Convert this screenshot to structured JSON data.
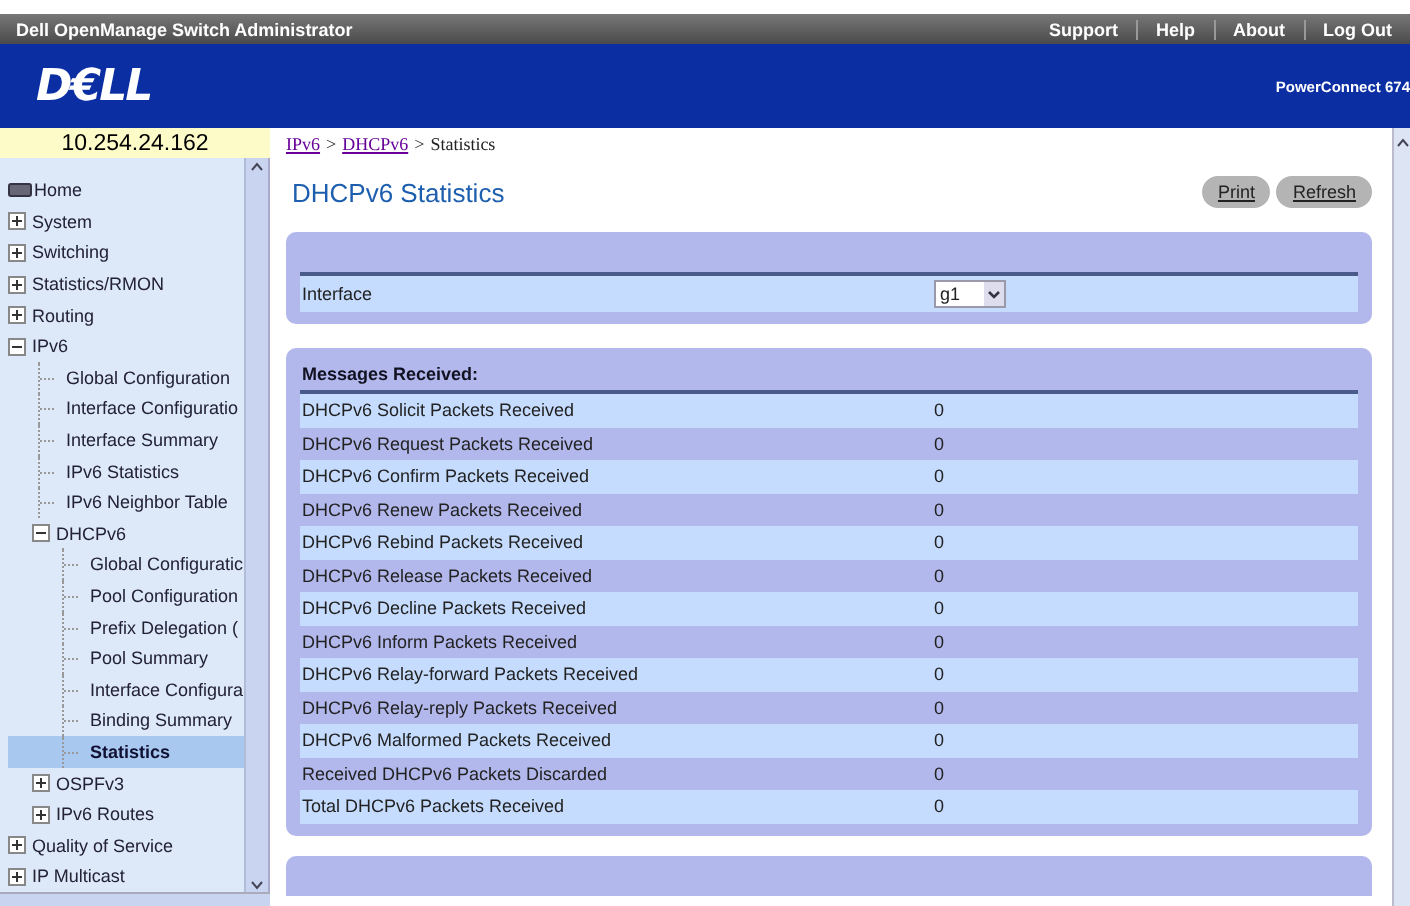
{
  "header": {
    "title": "Dell OpenManage Switch Administrator",
    "links": [
      "Support",
      "Help",
      "About",
      "Log Out"
    ],
    "logo": "D€LL",
    "model": "PowerConnect 674"
  },
  "ip_address": "10.254.24.162",
  "breadcrumb": [
    {
      "label": "IPv6",
      "kind": "link"
    },
    {
      "label": ">",
      "kind": "separator"
    },
    {
      "label": "DHCPv6",
      "kind": "link"
    },
    {
      "label": ">",
      "kind": "separator"
    },
    {
      "label": "Statistics",
      "kind": "current"
    }
  ],
  "sidebar": {
    "items": [
      {
        "label": "Home",
        "kind": "home",
        "selected": false
      },
      {
        "label": "System",
        "kind": "folder",
        "expanded": false,
        "selected": false
      },
      {
        "label": "Switching",
        "kind": "folder",
        "expanded": false,
        "selected": false
      },
      {
        "label": "Statistics/RMON",
        "kind": "folder",
        "expanded": false,
        "selected": false
      },
      {
        "label": "Routing",
        "kind": "folder",
        "expanded": false,
        "selected": false
      },
      {
        "label": "IPv6",
        "kind": "folder",
        "expanded": true,
        "selected": false,
        "children": [
          {
            "label": "Global Configuration",
            "kind": "leaf",
            "selected": false
          },
          {
            "label": "Interface Configuratio",
            "kind": "leaf",
            "selected": false
          },
          {
            "label": "Interface Summary",
            "kind": "leaf",
            "selected": false
          },
          {
            "label": "IPv6 Statistics",
            "kind": "leaf",
            "selected": false
          },
          {
            "label": "IPv6 Neighbor Table",
            "kind": "leaf",
            "selected": false
          },
          {
            "label": "DHCPv6",
            "kind": "folder",
            "expanded": true,
            "selected": false,
            "children": [
              {
                "label": "Global Configuratic",
                "kind": "leaf",
                "selected": false
              },
              {
                "label": "Pool Configuration",
                "kind": "leaf",
                "selected": false
              },
              {
                "label": "Prefix Delegation (",
                "kind": "leaf",
                "selected": false
              },
              {
                "label": "Pool Summary",
                "kind": "leaf",
                "selected": false
              },
              {
                "label": "Interface Configura",
                "kind": "leaf",
                "selected": false
              },
              {
                "label": "Binding Summary",
                "kind": "leaf",
                "selected": false
              },
              {
                "label": "Statistics",
                "kind": "leaf",
                "selected": true
              }
            ]
          },
          {
            "label": "OSPFv3",
            "kind": "folder",
            "expanded": false,
            "selected": false
          },
          {
            "label": "IPv6 Routes",
            "kind": "folder",
            "expanded": false,
            "selected": false
          }
        ]
      },
      {
        "label": "Quality of Service",
        "kind": "folder",
        "expanded": false,
        "selected": false
      },
      {
        "label": "IP Multicast",
        "kind": "folder",
        "expanded": false,
        "selected": false
      }
    ]
  },
  "page": {
    "title": "DHCPv6 Statistics",
    "buttons": [
      "Print",
      "Refresh"
    ],
    "interface": {
      "label": "Interface",
      "value": "g1"
    },
    "section": {
      "title": "Messages Received:",
      "rows": [
        {
          "label": "DHCPv6 Solicit Packets Received",
          "value": "0"
        },
        {
          "label": "DHCPv6 Request Packets Received",
          "value": "0"
        },
        {
          "label": "DHCPv6 Confirm Packets Received",
          "value": "0"
        },
        {
          "label": "DHCPv6 Renew Packets Received",
          "value": "0"
        },
        {
          "label": "DHCPv6 Rebind Packets Received",
          "value": "0"
        },
        {
          "label": "DHCPv6 Release Packets Received",
          "value": "0"
        },
        {
          "label": "DHCPv6 Decline Packets Received",
          "value": "0"
        },
        {
          "label": "DHCPv6 Inform Packets Received",
          "value": "0"
        },
        {
          "label": "DHCPv6 Relay-forward Packets Received",
          "value": "0"
        },
        {
          "label": "DHCPv6 Relay-reply Packets Received",
          "value": "0"
        },
        {
          "label": "DHCPv6 Malformed Packets Received",
          "value": "0"
        },
        {
          "label": "Received DHCPv6 Packets Discarded",
          "value": "0"
        },
        {
          "label": "Total DHCPv6 Packets Received",
          "value": "0"
        }
      ]
    }
  }
}
